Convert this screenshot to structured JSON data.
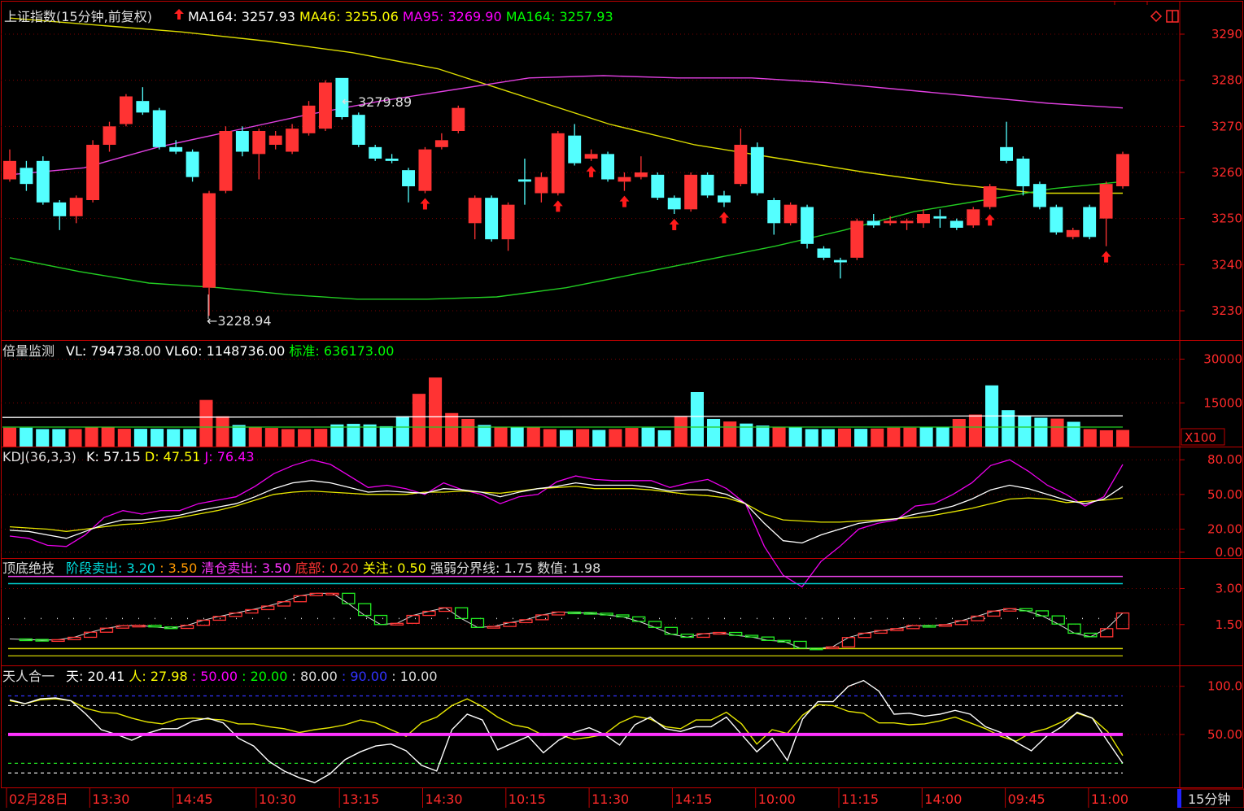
{
  "panels": {
    "price": {
      "title": "上证指数(15分钟,前复权)",
      "legend": [
        {
          "label": "MA164: 3257.93",
          "color": "#ffffff"
        },
        {
          "label": "MA46: 3255.06",
          "color": "#ffff00"
        },
        {
          "label": "MA95: 3269.90",
          "color": "#ff00ff"
        },
        {
          "label": "MA164: 3257.93",
          "color": "#00ff00"
        }
      ],
      "high_label": "3279.89",
      "low_label": "←3228.94",
      "yticks": [
        "3290",
        "3280",
        "3270",
        "3260",
        "3250",
        "3240",
        "3230"
      ]
    },
    "volume": {
      "title": "倍量监测",
      "legend": [
        {
          "label": "VL: 794738.00",
          "color": "#ffffff"
        },
        {
          "label": "VL60: 1148736.00",
          "color": "#ffffff"
        },
        {
          "label": "标准: 636173.00",
          "color": "#00ff00"
        }
      ],
      "yticks": [
        "30000",
        "15000"
      ],
      "unit": "X100"
    },
    "kdj": {
      "title": "KDJ(36,3,3)",
      "legend": [
        {
          "label": "K: 57.15",
          "color": "#ffffff"
        },
        {
          "label": "D: 47.51",
          "color": "#ffff00"
        },
        {
          "label": "J: 76.43",
          "color": "#ff00ff"
        }
      ],
      "yticks": [
        "80.00",
        "50.00",
        "20.00",
        "0.00"
      ]
    },
    "dingdi": {
      "title": "顶底绝技",
      "legend": [
        {
          "label": "阶段卖出: 3.20",
          "color": "#00e0e0"
        },
        {
          "label": ": 3.50",
          "color": "#ff9900"
        },
        {
          "label": "清仓卖出: 3.50",
          "color": "#ff33ff"
        },
        {
          "label": "底部: 0.20",
          "color": "#ff3333"
        },
        {
          "label": "关注: 0.50",
          "color": "#ffff00"
        },
        {
          "label": "强弱分界线: 1.75",
          "color": "#dddddd"
        },
        {
          "label": "数值: 1.98",
          "color": "#dddddd"
        }
      ],
      "yticks": [
        "3.00",
        "1.50"
      ]
    },
    "tianren": {
      "title": "天人合一",
      "legend": [
        {
          "label": "天: 20.41",
          "color": "#ffffff"
        },
        {
          "label": "人: 27.98",
          "color": "#ffff00"
        },
        {
          "label": ": 50.00",
          "color": "#ff00ff"
        },
        {
          "label": ": 20.00",
          "color": "#00ff00"
        },
        {
          "label": ": 80.00",
          "color": "#dddddd"
        },
        {
          "label": ": 90.00",
          "color": "#3333ff"
        },
        {
          "label": ": 10.00",
          "color": "#dddddd"
        }
      ],
      "yticks": [
        "100.0",
        "50.00"
      ]
    }
  },
  "time_axis": {
    "labels": [
      "02月28日",
      "13:30",
      "14:45",
      "10:30",
      "13:15",
      "14:30",
      "10:15",
      "11:30",
      "14:15",
      "10:00",
      "11:15",
      "14:00",
      "09:45",
      "11:00"
    ],
    "period": "15分钟"
  },
  "colors": {
    "up": "#ff3333",
    "down": "#54ffff",
    "frame": "#c00000",
    "axis_text": "#ff2a2a"
  },
  "chart_data": [
    {
      "type": "candlestick",
      "name": "price",
      "ylim": [
        3224,
        3296
      ],
      "candles": [
        [
          3258.5,
          3262.5,
          3265.0,
          3258.0
        ],
        [
          3261.0,
          3257.5,
          3262.5,
          3256.0
        ],
        [
          3262.5,
          3253.5,
          3263.5,
          3253.0
        ],
        [
          3253.5,
          3250.5,
          3254.0,
          3247.5
        ],
        [
          3250.5,
          3254.5,
          3255.0,
          3249.0
        ],
        [
          3254.0,
          3266.0,
          3267.0,
          3253.5
        ],
        [
          3266.0,
          3270.0,
          3271.0,
          3264.5
        ],
        [
          3270.5,
          3276.5,
          3277.0,
          3270.0
        ],
        [
          3275.5,
          3273.0,
          3278.5,
          3272.5
        ],
        [
          3273.5,
          3265.5,
          3274.0,
          3265.0
        ],
        [
          3265.5,
          3264.5,
          3267.0,
          3264.0
        ],
        [
          3264.5,
          3259.0,
          3265.0,
          3258.0
        ],
        [
          3235.0,
          3255.5,
          3256.0,
          3228.9
        ],
        [
          3256.0,
          3269.0,
          3270.0,
          3255.5
        ],
        [
          3269.0,
          3264.5,
          3270.0,
          3263.5
        ],
        [
          3264.0,
          3269.0,
          3269.5,
          3258.5
        ],
        [
          3266.0,
          3268.0,
          3269.0,
          3265.0
        ],
        [
          3264.5,
          3269.5,
          3270.5,
          3264.0
        ],
        [
          3268.5,
          3274.5,
          3275.5,
          3268.0
        ],
        [
          3269.5,
          3279.5,
          3280.0,
          3269.0
        ],
        [
          3280.5,
          3272.0,
          3280.5,
          3271.5
        ],
        [
          3272.5,
          3266.0,
          3273.0,
          3265.5
        ],
        [
          3265.5,
          3263.0,
          3266.0,
          3262.5
        ],
        [
          3263.0,
          3262.5,
          3264.0,
          3262.0
        ],
        [
          3260.5,
          3257.0,
          3261.0,
          3253.5
        ],
        [
          3256.0,
          3265.0,
          3265.5,
          3255.5
        ],
        [
          3265.5,
          3267.0,
          3268.5,
          3265.0
        ],
        [
          3269.0,
          3274.0,
          3274.5,
          3268.5
        ],
        [
          3249.0,
          3254.5,
          3255.0,
          3245.5
        ],
        [
          3254.5,
          3245.5,
          3255.0,
          3245.0
        ],
        [
          3245.5,
          3253.0,
          3253.5,
          3243.0
        ],
        [
          3258.5,
          3258.0,
          3263.0,
          3253.0
        ],
        [
          3255.5,
          3259.0,
          3260.0,
          3253.5
        ],
        [
          3255.5,
          3268.5,
          3269.0,
          3255.0
        ],
        [
          3268.0,
          3262.0,
          3270.5,
          3261.5
        ],
        [
          3263.0,
          3264.0,
          3265.0,
          3262.5
        ],
        [
          3264.0,
          3258.5,
          3264.5,
          3258.0
        ],
        [
          3258.0,
          3259.0,
          3260.0,
          3256.0
        ],
        [
          3259.0,
          3260.0,
          3263.5,
          3258.5
        ],
        [
          3259.5,
          3254.5,
          3260.0,
          3254.0
        ],
        [
          3254.5,
          3252.0,
          3255.0,
          3251.0
        ],
        [
          3252.0,
          3259.5,
          3260.0,
          3251.5
        ],
        [
          3259.5,
          3255.0,
          3260.0,
          3254.5
        ],
        [
          3255.0,
          3253.5,
          3256.0,
          3252.5
        ],
        [
          3257.5,
          3266.0,
          3269.5,
          3257.0
        ],
        [
          3265.5,
          3255.5,
          3266.5,
          3255.0
        ],
        [
          3254.0,
          3249.0,
          3254.5,
          3246.5
        ],
        [
          3249.0,
          3253.0,
          3253.5,
          3248.5
        ],
        [
          3252.5,
          3244.5,
          3253.0,
          3243.5
        ],
        [
          3243.5,
          3241.5,
          3244.0,
          3241.0
        ],
        [
          3241.0,
          3240.5,
          3241.5,
          3237.0
        ],
        [
          3241.5,
          3249.5,
          3250.0,
          3241.0
        ],
        [
          3249.5,
          3248.5,
          3251.0,
          3248.0
        ],
        [
          3249.0,
          3249.5,
          3250.5,
          3248.5
        ],
        [
          3249.0,
          3249.5,
          3250.0,
          3247.5
        ],
        [
          3249.0,
          3251.0,
          3252.0,
          3248.0
        ],
        [
          3250.5,
          3250.0,
          3252.0,
          3248.0
        ],
        [
          3249.5,
          3248.0,
          3250.0,
          3247.5
        ],
        [
          3248.5,
          3252.0,
          3252.5,
          3248.0
        ],
        [
          3252.5,
          3257.0,
          3257.5,
          3252.0
        ],
        [
          3265.5,
          3262.5,
          3271.0,
          3262.0
        ],
        [
          3263.0,
          3257.0,
          3263.5,
          3255.0
        ],
        [
          3257.5,
          3252.5,
          3258.0,
          3252.0
        ],
        [
          3252.5,
          3247.0,
          3253.0,
          3246.5
        ],
        [
          3246.0,
          3247.5,
          3248.0,
          3245.5
        ],
        [
          3252.5,
          3246.0,
          3253.0,
          3245.5
        ],
        [
          3250.0,
          3257.5,
          3258.0,
          3244.0
        ],
        [
          3257.0,
          3264.0,
          3264.5,
          3256.5
        ]
      ],
      "ma95": [
        3259.5,
        3261.0,
        3265.5,
        3269.0,
        3272.5,
        3275.5,
        3278.0,
        3280.5,
        3281.0,
        3280.5,
        3280.5,
        3279.5,
        3278.0,
        3276.5,
        3275.0,
        3274.0
      ],
      "ma46": [
        3293.5,
        3292.0,
        3290.5,
        3288.5,
        3286.0,
        3282.5,
        3276.5,
        3270.5,
        3266.0,
        3263.0,
        3260.0,
        3257.5,
        3255.5,
        3255.5
      ],
      "ma164": [
        3241.5,
        3238.5,
        3236.0,
        3235.0,
        3233.5,
        3232.5,
        3232.5,
        3233.0,
        3235.0,
        3238.0,
        3241.0,
        3244.0,
        3247.5,
        3251.5,
        3254.0,
        3256.5,
        3258.0
      ],
      "arrows_up": [
        25,
        33,
        35,
        37,
        40,
        43,
        59,
        66
      ]
    },
    {
      "type": "bar",
      "name": "volume",
      "ylim": [
        0,
        36000
      ],
      "values": [
        6500,
        6500,
        6000,
        6000,
        6000,
        6800,
        6800,
        6100,
        6100,
        6100,
        6000,
        6000,
        16000,
        10400,
        7400,
        6800,
        6400,
        6000,
        6000,
        6100,
        7600,
        7800,
        7600,
        7000,
        10400,
        18100,
        23700,
        11500,
        9500,
        7400,
        6800,
        6800,
        6600,
        6000,
        5700,
        6000,
        5700,
        6000,
        6400,
        6500,
        5600,
        10500,
        18700,
        9500,
        8600,
        7900,
        7200,
        6700,
        6600,
        6000,
        6000,
        6200,
        6100,
        6200,
        6500,
        6500,
        6600,
        6800,
        9500,
        11000,
        21000,
        12500,
        10700,
        9900,
        9600,
        8500,
        6000,
        5600,
        5700
      ],
      "avg_line": 10000,
      "std_line": 6700
    },
    {
      "type": "line",
      "name": "kdj",
      "ylim": [
        -5,
        90
      ],
      "K": [
        19,
        18,
        15,
        12,
        18,
        24,
        28,
        28,
        30,
        32,
        36,
        39,
        42,
        48,
        55,
        60,
        62,
        60,
        56,
        52,
        53,
        52,
        51,
        55,
        54,
        52,
        48,
        52,
        55,
        57,
        60,
        58,
        58,
        58,
        56,
        53,
        54,
        54,
        50,
        42,
        25,
        10,
        8,
        15,
        20,
        25,
        27,
        29,
        33,
        36,
        40,
        46,
        54,
        58,
        55,
        50,
        45,
        42,
        46,
        57
      ],
      "D": [
        22,
        21,
        20,
        18,
        20,
        22,
        24,
        25,
        27,
        30,
        33,
        36,
        40,
        45,
        50,
        52,
        53,
        52,
        51,
        50,
        50,
        50,
        52,
        52,
        53,
        52,
        51,
        53,
        55,
        56,
        57,
        55,
        55,
        55,
        54,
        52,
        50,
        49,
        47,
        42,
        33,
        28,
        27,
        26,
        26,
        27,
        28,
        29,
        30,
        32,
        35,
        38,
        42,
        46,
        47,
        46,
        43,
        44,
        45,
        47
      ],
      "J": [
        14,
        12,
        6,
        5,
        15,
        30,
        36,
        33,
        36,
        36,
        42,
        45,
        48,
        57,
        68,
        75,
        80,
        76,
        66,
        56,
        58,
        55,
        50,
        60,
        54,
        50,
        42,
        48,
        50,
        61,
        66,
        63,
        62,
        62,
        62,
        56,
        60,
        63,
        55,
        42,
        5,
        -20,
        -30,
        -8,
        5,
        20,
        25,
        28,
        40,
        42,
        50,
        60,
        75,
        80,
        70,
        58,
        50,
        40,
        48,
        76
      ]
    },
    {
      "type": "line",
      "name": "dingdi",
      "ylim": [
        -0.2,
        4.2
      ],
      "values": [
        0.9,
        0.88,
        0.85,
        0.87,
        0.97,
        1.18,
        1.35,
        1.45,
        1.47,
        1.4,
        1.34,
        1.47,
        1.68,
        1.84,
        1.98,
        2.12,
        2.27,
        2.45,
        2.7,
        2.8,
        2.8,
        2.37,
        1.88,
        1.5,
        1.55,
        1.88,
        2.05,
        2.2,
        1.75,
        1.38,
        1.42,
        1.58,
        1.7,
        1.9,
        2.02,
        2.0,
        1.97,
        1.9,
        1.82,
        1.63,
        1.38,
        1.1,
        0.97,
        1.12,
        1.17,
        1.05,
        0.98,
        0.84,
        0.8,
        0.52,
        0.5,
        0.57,
        0.96,
        1.14,
        1.25,
        1.33,
        1.46,
        1.44,
        1.5,
        1.66,
        1.85,
        2.06,
        2.16,
        2.07,
        1.86,
        1.52,
        1.14,
        0.99,
        1.33,
        1.98
      ],
      "lines": {
        "top": 3.5,
        "stage": 3.2,
        "mid": 1.75,
        "focus": 0.5,
        "bottom": 0.2
      }
    },
    {
      "type": "line",
      "name": "tianren",
      "ylim": [
        -5,
        120
      ],
      "tian": [
        86,
        82,
        87,
        88,
        85,
        71,
        55,
        50,
        44,
        51,
        56,
        56,
        64,
        67,
        62,
        46,
        38,
        22,
        12,
        5,
        0,
        9,
        24,
        32,
        38,
        40,
        33,
        18,
        12,
        55,
        71,
        65,
        34,
        41,
        48,
        31,
        44,
        52,
        57,
        50,
        39,
        60,
        68,
        56,
        53,
        58,
        58,
        68,
        50,
        32,
        46,
        23,
        66,
        84,
        84,
        100,
        106,
        95,
        71,
        72,
        69,
        71,
        75,
        71,
        58,
        52,
        42,
        33,
        48,
        58,
        73,
        67,
        43,
        20
      ],
      "ren": [
        85,
        82,
        86,
        87,
        85,
        77,
        73,
        72,
        67,
        63,
        61,
        66,
        67,
        66,
        65,
        61,
        61,
        58,
        56,
        52,
        55,
        57,
        60,
        65,
        62,
        55,
        48,
        62,
        68,
        80,
        87,
        79,
        68,
        60,
        57,
        49,
        50,
        45,
        47,
        50,
        62,
        69,
        66,
        58,
        56,
        65,
        65,
        73,
        61,
        40,
        55,
        51,
        70,
        81,
        80,
        74,
        72,
        62,
        62,
        60,
        61,
        64,
        68,
        62,
        56,
        48,
        43,
        52,
        56,
        63,
        72,
        67,
        53,
        28
      ]
    }
  ]
}
